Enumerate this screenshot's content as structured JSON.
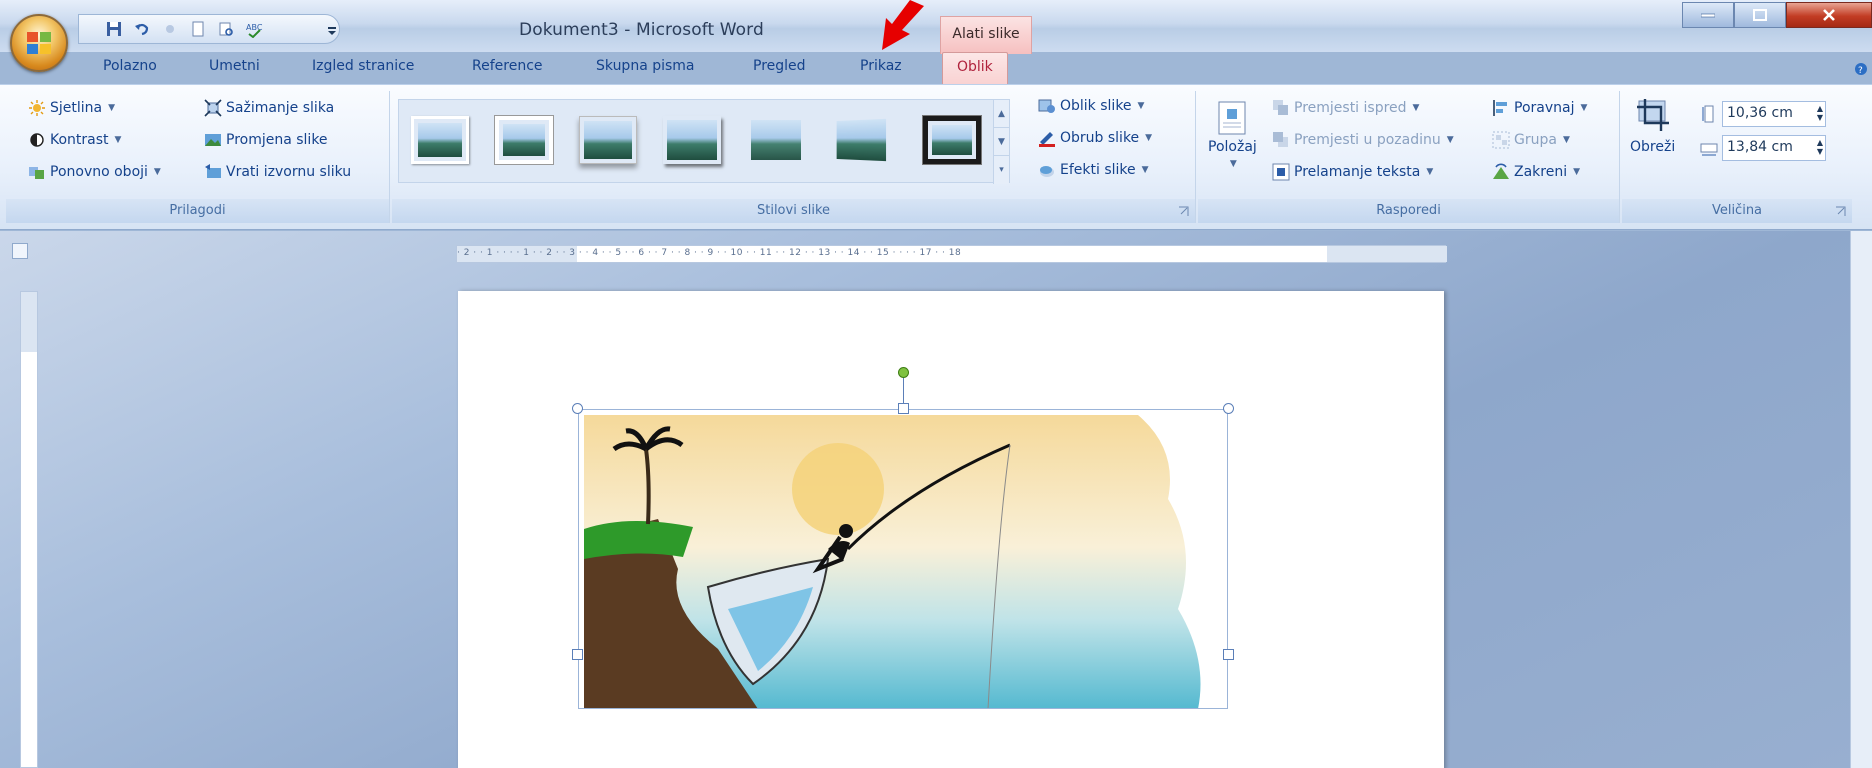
{
  "window": {
    "title": "Dokument3 - Microsoft Word",
    "context_tab_header": "Alati slike"
  },
  "tabs": [
    {
      "label": "Polazno",
      "active": false
    },
    {
      "label": "Umetni",
      "active": false
    },
    {
      "label": "Izgled stranice",
      "active": false
    },
    {
      "label": "Reference",
      "active": false
    },
    {
      "label": "Skupna pisma",
      "active": false
    },
    {
      "label": "Pregled",
      "active": false
    },
    {
      "label": "Prikaz",
      "active": false
    },
    {
      "label": "Oblik",
      "active": true
    }
  ],
  "ribbon": {
    "prilagodi": {
      "label": "Prilagodi",
      "sjetlina": "Sjetlina",
      "kontrast": "Kontrast",
      "ponovno_oboji": "Ponovno oboji",
      "sazimanje": "Sažimanje slika",
      "promjena": "Promjena slike",
      "vrati": "Vrati izvornu sliku"
    },
    "stilovi": {
      "label": "Stilovi slike",
      "oblik_slike": "Oblik slike",
      "obrub_slike": "Obrub slike",
      "efekti_slike": "Efekti slike"
    },
    "rasporedi": {
      "label": "Rasporedi",
      "polozaj": "Položaj",
      "premjesti_ispred": "Premjesti ispred",
      "premjesti_pozadinu": "Premjesti u pozadinu",
      "prelamanje": "Prelamanje teksta",
      "poravnaj": "Poravnaj",
      "grupa": "Grupa",
      "zakreni": "Zakreni"
    },
    "velicina": {
      "label": "Veličina",
      "obrezi": "Obreži",
      "height": "10,36 cm",
      "width": "13,84 cm"
    }
  },
  "ruler": {
    "text": "· 2 · · 1 · · · · 1 · · 2 · · 3 · · 4 · · 5 · · 6 · · 7 · · 8 · · 9 · · 10 · · 11 · · 12 · · 13 · · 14 · · 15 · · · · 17 · · 18"
  },
  "colors": {
    "accent": "#15428b",
    "context_tab": "#f9d2d2",
    "arrow": "#e60000"
  }
}
